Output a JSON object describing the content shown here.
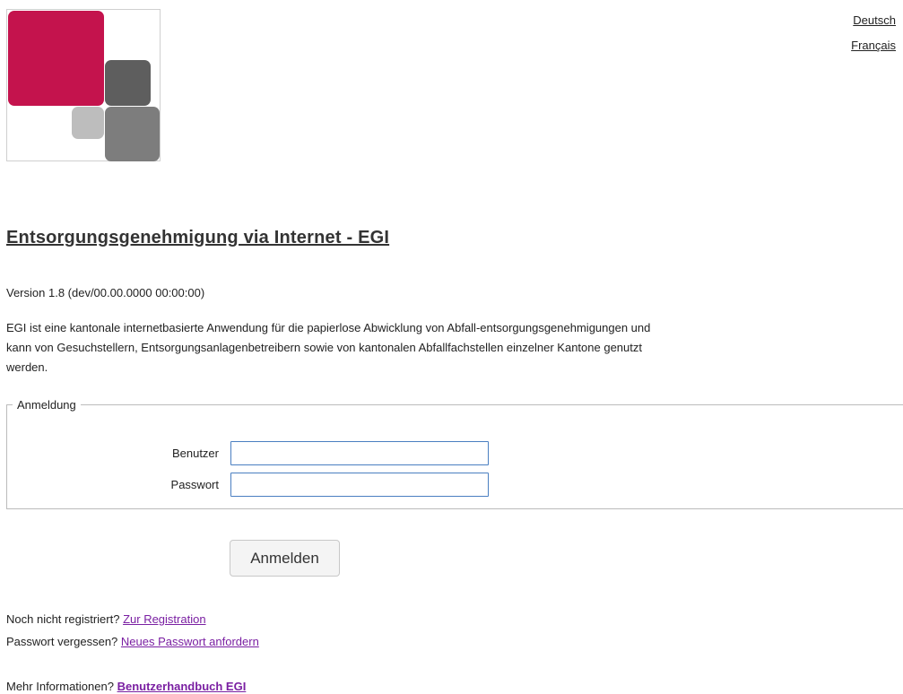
{
  "languages": {
    "german": "Deutsch",
    "french": "Français"
  },
  "title": "Entsorgungsgenehmigung via Internet - EGI",
  "version": "Version 1.8 (dev/00.00.0000 00:00:00)",
  "description": "EGI ist eine kantonale internetbasierte Anwendung für die papierlose Abwicklung von Abfall-entsorgungsgenehmigungen und kann von Gesuchstellern, Entsorgungsanlagenbetreibern sowie von kantonalen Abfallfachstellen einzelner Kantone genutzt werden.",
  "login": {
    "legend": "Anmeldung",
    "user_label": "Benutzer",
    "user_value": "",
    "password_label": "Passwort",
    "password_value": "",
    "submit_label": "Anmelden"
  },
  "links": {
    "register_prompt": "Noch nicht registriert?",
    "register_link": "Zur Registration",
    "forgot_prompt": "Passwort vergessen?",
    "forgot_link": "Neues Passwort anfordern",
    "info_prompt": "Mehr Informationen?",
    "info_link": "Benutzerhandbuch EGI"
  },
  "colors": {
    "brand": "#c4134d",
    "link": "#7a1fa2",
    "input_border": "#4a7fc1"
  }
}
